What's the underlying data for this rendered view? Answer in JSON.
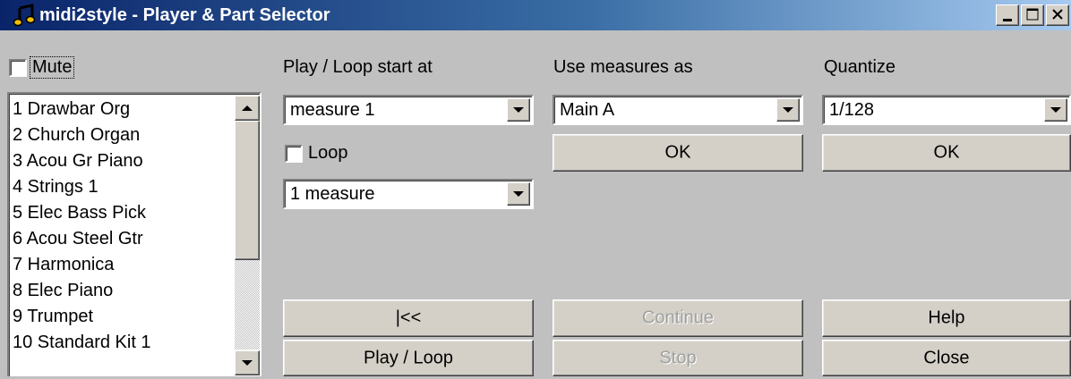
{
  "window": {
    "title": "midi2style - Player & Part Selector"
  },
  "mute": {
    "label": "Mute",
    "checked": false
  },
  "parts": {
    "items": [
      "1 Drawbar Org",
      "2 Church Organ",
      "3 Acou Gr Piano",
      "4 Strings 1",
      "5 Elec Bass Pick",
      "6 Acou Steel Gtr",
      "7 Harmonica",
      "8 Elec Piano",
      "9 Trumpet",
      "10 Standard Kit 1"
    ]
  },
  "play_section": {
    "label": "Play / Loop start at",
    "start_value": "measure 1",
    "loop_label": "Loop",
    "loop_checked": false,
    "length_value": "1 measure"
  },
  "measures_section": {
    "label": "Use measures as",
    "value": "Main A",
    "ok_label": "OK"
  },
  "quantize_section": {
    "label": "Quantize",
    "value": "1/128",
    "ok_label": "OK"
  },
  "buttons": {
    "rewind": "|<<",
    "play_loop": "Play / Loop",
    "continue": "Continue",
    "stop": "Stop",
    "help": "Help",
    "close": "Close"
  }
}
